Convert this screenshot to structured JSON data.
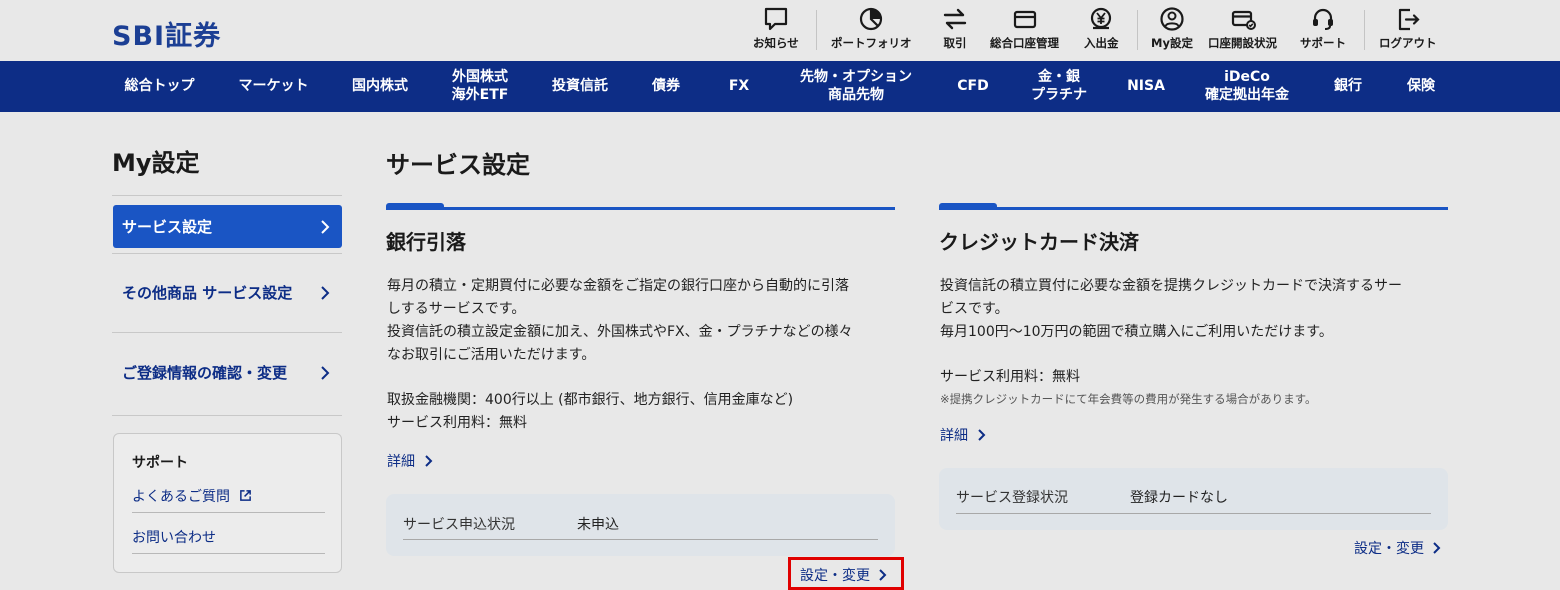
{
  "header": {
    "logo": "SBI証券",
    "utility": [
      {
        "label": "お知らせ",
        "icon": "notice-icon"
      },
      {
        "label": "ポートフォリオ",
        "icon": "portfolio-icon"
      },
      {
        "label": "取引",
        "icon": "trade-icon"
      },
      {
        "label": "総合口座管理",
        "icon": "account-card-icon"
      },
      {
        "label": "入出金",
        "icon": "yen-deposit-icon"
      },
      {
        "label": "My設定",
        "icon": "user-settings-icon"
      },
      {
        "label": "口座開設状況",
        "icon": "account-open-icon"
      },
      {
        "label": "サポート",
        "icon": "headset-icon"
      },
      {
        "label": "ログアウト",
        "icon": "logout-icon"
      }
    ]
  },
  "nav": [
    {
      "l1": "総合トップ",
      "l2": ""
    },
    {
      "l1": "マーケット",
      "l2": ""
    },
    {
      "l1": "国内株式",
      "l2": ""
    },
    {
      "l1": "外国株式",
      "l2": "海外ETF"
    },
    {
      "l1": "投資信託",
      "l2": ""
    },
    {
      "l1": "債券",
      "l2": ""
    },
    {
      "l1": "FX",
      "l2": ""
    },
    {
      "l1": "先物・オプション",
      "l2": "商品先物"
    },
    {
      "l1": "CFD",
      "l2": ""
    },
    {
      "l1": "金・銀",
      "l2": "プラチナ"
    },
    {
      "l1": "NISA",
      "l2": ""
    },
    {
      "l1": "iDeCo",
      "l2": "確定拠出年金"
    },
    {
      "l1": "銀行",
      "l2": ""
    },
    {
      "l1": "保険",
      "l2": ""
    }
  ],
  "sidebar": {
    "title": "My設定",
    "items": [
      {
        "label": "サービス設定",
        "active": true
      },
      {
        "label": "その他商品 サービス設定",
        "active": false
      },
      {
        "label": "ご登録情報の確認・変更",
        "active": false
      }
    ],
    "support": {
      "title": "サポート",
      "links": [
        "よくあるご質問",
        "お問い合わせ"
      ]
    }
  },
  "main": {
    "title": "サービス設定",
    "cards": [
      {
        "title": "銀行引落",
        "desc": [
          "毎月の積立・定期買付に必要な金額をご指定の銀行口座から自動的に引落",
          "しするサービスです。",
          "投資信託の積立設定金額に加え、外国株式やFX、金・プラチナなどの様々",
          "なお取引にご活用いただけます。"
        ],
        "info": [
          "取扱金融機関：400行以上 (都市銀行、地方銀行、信用金庫など)",
          "サービス利用料：無料"
        ],
        "note": "",
        "detail": "詳細",
        "status_label": "サービス申込状況",
        "status_value": "未申込",
        "action": "設定・変更"
      },
      {
        "title": "クレジットカード決済",
        "desc": [
          "投資信託の積立買付に必要な金額を提携クレジットカードで決済するサー",
          "ビスです。",
          "毎月100円〜10万円の範囲で積立購入にご利用いただけます。"
        ],
        "info": [
          "サービス利用料：無料"
        ],
        "note": "※提携クレジットカードにて年会費等の費用が発生する場合があります。",
        "detail": "詳細",
        "status_label": "サービス登録状況",
        "status_value": "登録カードなし",
        "action": "設定・変更"
      }
    ]
  },
  "colors": {
    "brand": "#1c3f94",
    "nav_bg": "#0d2d86",
    "accent": "#1a55c4",
    "highlight": "#e00000"
  }
}
